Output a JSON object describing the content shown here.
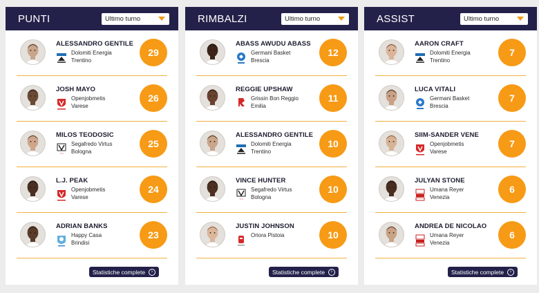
{
  "nav": {
    "prev_icon": "chevron-left-icon",
    "next_icon": "chevron-right-icon",
    "prev_glyph": "‹",
    "next_glyph": "›"
  },
  "colors": {
    "header": "#23214a",
    "accent": "#f79a15",
    "divider": "#f0b040"
  },
  "full_stats_icon": "circle-arrow-right-icon",
  "cards": [
    {
      "title": "PUNTI",
      "filter": "Ultimo turno",
      "footer": "Statistiche complete",
      "players": [
        {
          "name": "ALESSANDRO GENTILE",
          "team_line1": "Dolomiti Energia",
          "team_line2": "Trentino",
          "value": "29",
          "logo": "dolomiti-logo",
          "skin": "#c9a58a",
          "hair": "#2b1d15"
        },
        {
          "name": "JOSH MAYO",
          "team_line1": "Openjobmetis",
          "team_line2": "Varese",
          "value": "26",
          "logo": "varese-logo",
          "skin": "#6b4a34",
          "hair": "#1e1410"
        },
        {
          "name": "MILOS TEODOSIC",
          "team_line1": "Segafredo Virtus",
          "team_line2": "Bologna",
          "value": "25",
          "logo": "virtus-logo",
          "skin": "#cfa68c",
          "hair": "#3a2a22"
        },
        {
          "name": "L.J. PEAK",
          "team_line1": "Openjobmetis",
          "team_line2": "Varese",
          "value": "24",
          "logo": "varese-logo",
          "skin": "#4a3022",
          "hair": "#140d0a"
        },
        {
          "name": "ADRIAN BANKS",
          "team_line1": "Happy Casa",
          "team_line2": "Brindisi",
          "value": "23",
          "logo": "brindisi-logo",
          "skin": "#5a3b2a",
          "hair": "#1a110c"
        }
      ]
    },
    {
      "title": "RIMBALZI",
      "filter": "Ultimo turno",
      "footer": "Statistiche complete",
      "players": [
        {
          "name": "ABASS AWUDU ABASS",
          "team_line1": "Germani Basket",
          "team_line2": "Brescia",
          "value": "12",
          "logo": "brescia-logo",
          "skin": "#3c2419",
          "hair": "#120b08"
        },
        {
          "name": "REGGIE UPSHAW",
          "team_line1": "Grissin Bon Reggio",
          "team_line2": "Emilia",
          "value": "11",
          "logo": "reggio-logo",
          "skin": "#6a4330",
          "hair": "#1a100b"
        },
        {
          "name": "ALESSANDRO GENTILE",
          "team_line1": "Dolomiti Energia",
          "team_line2": "Trentino",
          "value": "10",
          "logo": "dolomiti-logo",
          "skin": "#c9a58a",
          "hair": "#2b1d15"
        },
        {
          "name": "VINCE HUNTER",
          "team_line1": "Segafredo Virtus",
          "team_line2": "Bologna",
          "value": "10",
          "logo": "virtus-logo",
          "skin": "#4d3022",
          "hair": "#150d09"
        },
        {
          "name": "JUSTIN JOHNSON",
          "team_line1": "Oriora Pistoia",
          "team_line2": "",
          "value": "10",
          "logo": "pistoia-logo",
          "skin": "#dcb69a",
          "hair": "#6a5040"
        }
      ]
    },
    {
      "title": "ASSIST",
      "filter": "Ultimo turno",
      "footer": "Statistiche complete",
      "players": [
        {
          "name": "AARON CRAFT",
          "team_line1": "Dolomiti Energia",
          "team_line2": "Trentino",
          "value": "7",
          "logo": "dolomiti-logo",
          "skin": "#dbb499",
          "hair": "#5a4536"
        },
        {
          "name": "LUCA VITALI",
          "team_line1": "Germani Basket",
          "team_line2": "Brescia",
          "value": "7",
          "logo": "brescia-logo",
          "skin": "#c8a186",
          "hair": "#241812"
        },
        {
          "name": "SIIM-SANDER VENE",
          "team_line1": "Openjobmetis",
          "team_line2": "Varese",
          "value": "7",
          "logo": "varese-logo",
          "skin": "#d8b294",
          "hair": "#7a5a40"
        },
        {
          "name": "JULYAN STONE",
          "team_line1": "Umana Reyer",
          "team_line2": "Venezia",
          "value": "6",
          "logo": "venezia-logo",
          "skin": "#4a2e20",
          "hair": "#120b08"
        },
        {
          "name": "ANDREA DE NICOLAO",
          "team_line1": "Umana Reyer",
          "team_line2": "Venezia",
          "value": "6",
          "logo": "venezia-logo",
          "skin": "#caa386",
          "hair": "#3a2a20"
        }
      ]
    }
  ]
}
